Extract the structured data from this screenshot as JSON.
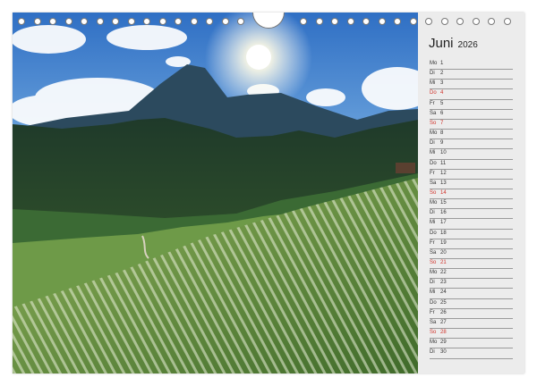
{
  "calendar": {
    "month": "Juni",
    "year": "2026",
    "days": [
      {
        "name": "Mo",
        "num": "1"
      },
      {
        "name": "Di",
        "num": "2"
      },
      {
        "name": "Mi",
        "num": "3"
      },
      {
        "name": "Do",
        "num": "4",
        "holiday": true
      },
      {
        "name": "Fr",
        "num": "5"
      },
      {
        "name": "Sa",
        "num": "6"
      },
      {
        "name": "So",
        "num": "7",
        "sunday": true
      },
      {
        "name": "Mo",
        "num": "8"
      },
      {
        "name": "Di",
        "num": "9"
      },
      {
        "name": "Mi",
        "num": "10"
      },
      {
        "name": "Do",
        "num": "11"
      },
      {
        "name": "Fr",
        "num": "12"
      },
      {
        "name": "Sa",
        "num": "13"
      },
      {
        "name": "So",
        "num": "14",
        "sunday": true
      },
      {
        "name": "Mo",
        "num": "15"
      },
      {
        "name": "Di",
        "num": "16"
      },
      {
        "name": "Mi",
        "num": "17"
      },
      {
        "name": "Do",
        "num": "18"
      },
      {
        "name": "Fr",
        "num": "19"
      },
      {
        "name": "Sa",
        "num": "20"
      },
      {
        "name": "So",
        "num": "21",
        "sunday": true
      },
      {
        "name": "Mo",
        "num": "22"
      },
      {
        "name": "Di",
        "num": "23"
      },
      {
        "name": "Mi",
        "num": "24"
      },
      {
        "name": "Do",
        "num": "25"
      },
      {
        "name": "Fr",
        "num": "26"
      },
      {
        "name": "Sa",
        "num": "27"
      },
      {
        "name": "So",
        "num": "28",
        "sunday": true
      },
      {
        "name": "Mo",
        "num": "29"
      },
      {
        "name": "Di",
        "num": "30"
      }
    ]
  },
  "colors": {
    "sunday": "#d0342c",
    "panel": "#ececec",
    "sky": "#3d7fd0",
    "meadow": "#6f9a3e"
  }
}
